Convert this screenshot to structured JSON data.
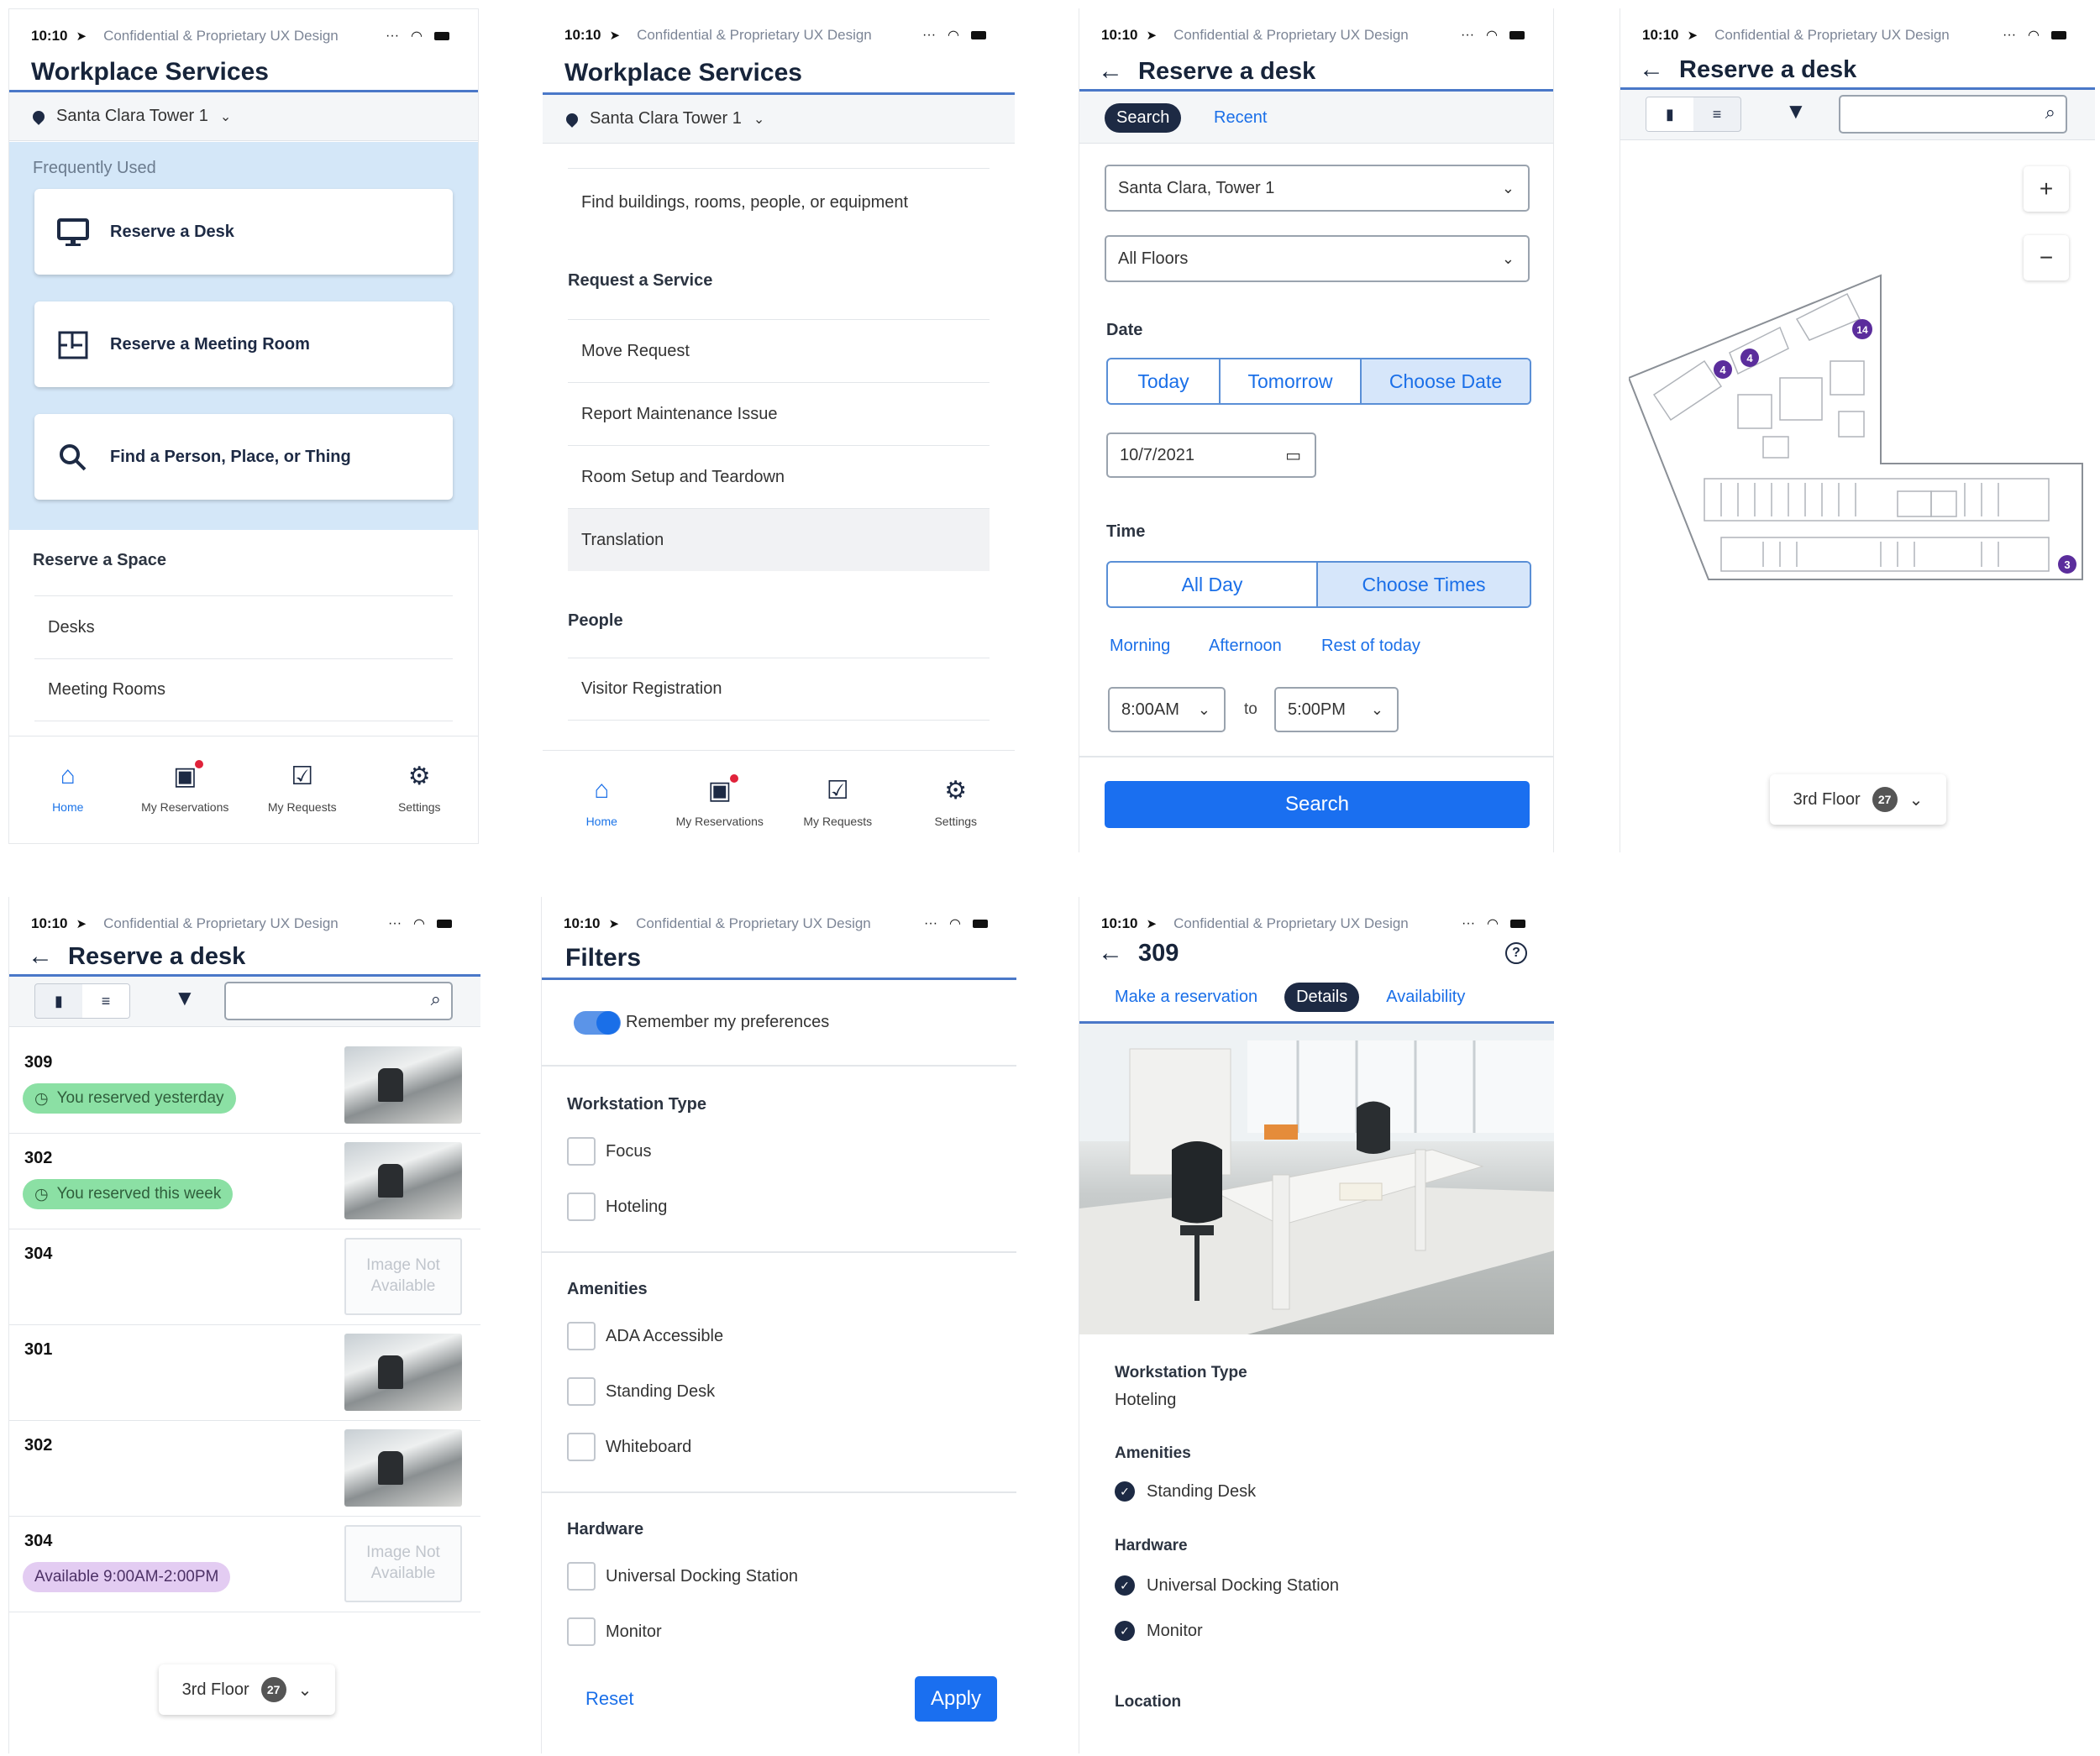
{
  "status_bar": {
    "time": "10:10",
    "confidential": "Confidential & Proprietary UX Design"
  },
  "home": {
    "title": "Workplace Services",
    "location": "Santa Clara Tower 1",
    "frequently_used_label": "Frequently Used",
    "cards": [
      "Reserve a Desk",
      "Reserve a Meeting Room",
      "Find a Person, Place, or Thing"
    ],
    "reserve_space_label": "Reserve a Space",
    "reserve_space_items": [
      "Desks",
      "Meeting Rooms"
    ]
  },
  "home_scrolled": {
    "title": "Workplace Services",
    "location": "Santa Clara Tower 1",
    "find_item": "Find buildings, rooms, people, or equipment",
    "request_service_label": "Request a Service",
    "service_items": [
      "Move Request",
      "Report Maintenance Issue",
      "Room Setup and Teardown",
      "Translation"
    ],
    "people_label": "People",
    "people_items": [
      "Visitor Registration"
    ]
  },
  "tabbar": {
    "tabs": [
      "Home",
      "My Reservations",
      "My Requests",
      "Settings"
    ]
  },
  "reserve_search": {
    "title": "Reserve a desk",
    "tabs": [
      "Search",
      "Recent"
    ],
    "building": "Santa Clara, Tower 1",
    "floor": "All Floors",
    "date_label": "Date",
    "date_options": [
      "Today",
      "Tomorrow",
      "Choose Date"
    ],
    "date_value": "10/7/2021",
    "time_label": "Time",
    "time_options": [
      "All Day",
      "Choose Times"
    ],
    "time_presets": [
      "Morning",
      "Afternoon",
      "Rest of today"
    ],
    "start_time": "8:00AM",
    "to_label": "to",
    "end_time": "5:00PM",
    "search_button": "Search"
  },
  "reserve_map": {
    "title": "Reserve a desk",
    "zoom_in": "+",
    "zoom_out": "−",
    "floor_label": "3rd Floor",
    "floor_count": "27",
    "markers": [
      "4",
      "4",
      "14",
      "3"
    ]
  },
  "reserve_list": {
    "title": "Reserve a desk",
    "floor_label": "3rd Floor",
    "floor_count": "27",
    "rows": [
      {
        "num": "309",
        "badge": "You reserved yesterday",
        "badge_type": "green",
        "image": "photo"
      },
      {
        "num": "302",
        "badge": "You reserved this week",
        "badge_type": "green",
        "image": "photo"
      },
      {
        "num": "304",
        "badge": "",
        "badge_type": "",
        "image": "none"
      },
      {
        "num": "301",
        "badge": "",
        "badge_type": "",
        "image": "photo"
      },
      {
        "num": "302",
        "badge": "",
        "badge_type": "",
        "image": "photo"
      },
      {
        "num": "304",
        "badge": "Available 9:00AM-2:00PM",
        "badge_type": "purple",
        "image": "none"
      }
    ],
    "image_not_available": [
      "Image Not",
      "Available"
    ]
  },
  "filters": {
    "title": "Filters",
    "remember": "Remember my preferences",
    "workstation_type_label": "Workstation Type",
    "workstation_types": [
      "Focus",
      "Hoteling"
    ],
    "amenities_label": "Amenities",
    "amenities": [
      "ADA Accessible",
      "Standing Desk",
      "Whiteboard"
    ],
    "hardware_label": "Hardware",
    "hardware": [
      "Universal Docking Station",
      "Monitor"
    ],
    "reset": "Reset",
    "apply": "Apply"
  },
  "details": {
    "title": "309",
    "tabs": [
      "Make a reservation",
      "Details",
      "Availability"
    ],
    "workstation_type_label": "Workstation Type",
    "workstation_type": "Hoteling",
    "amenities_label": "Amenities",
    "amenities": [
      "Standing Desk"
    ],
    "hardware_label": "Hardware",
    "hardware": [
      "Universal Docking Station",
      "Monitor"
    ],
    "location_label": "Location"
  },
  "colors": {
    "accent": "#1a6fe8",
    "navy": "#1d2a44",
    "header_line": "#4a78c8",
    "green_badge": "#8be0a4",
    "purple_badge": "#e3ccf2"
  }
}
